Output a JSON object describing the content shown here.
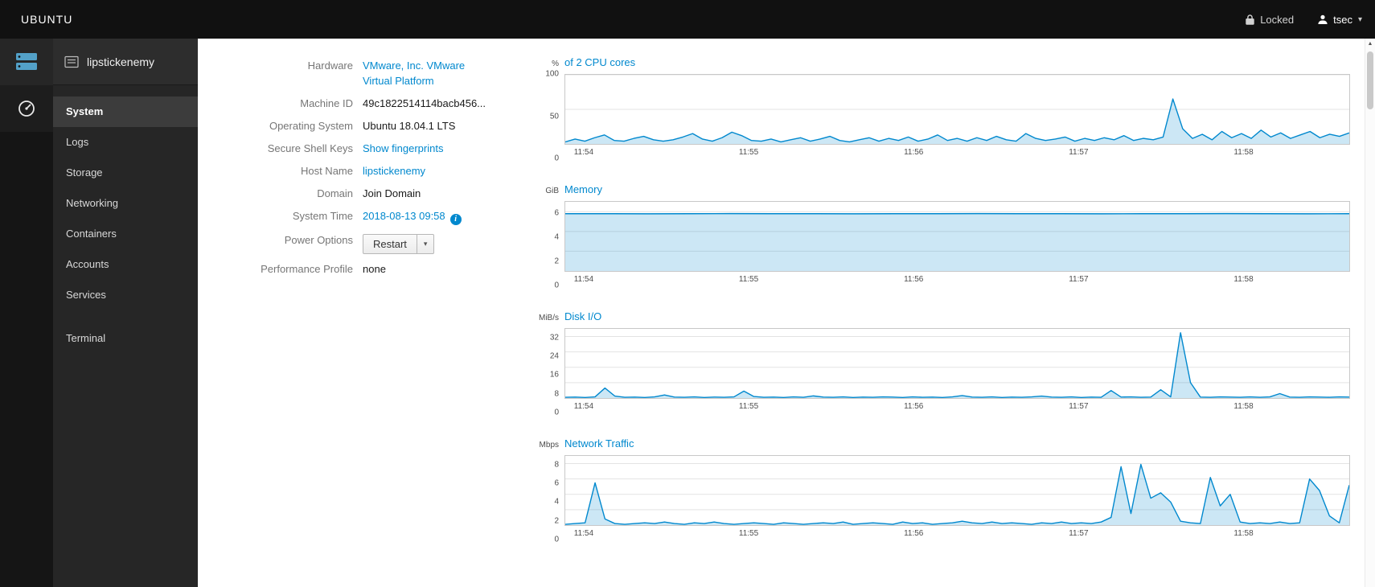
{
  "topbar": {
    "brand": "UBUNTU",
    "locked_label": "Locked",
    "user_label": "tsec"
  },
  "sidebar": {
    "host": "lipstickenemy",
    "items": [
      {
        "label": "System",
        "active": true
      },
      {
        "label": "Logs",
        "active": false
      },
      {
        "label": "Storage",
        "active": false
      },
      {
        "label": "Networking",
        "active": false
      },
      {
        "label": "Containers",
        "active": false
      },
      {
        "label": "Accounts",
        "active": false
      },
      {
        "label": "Services",
        "active": false
      }
    ],
    "tools": [
      {
        "label": "Terminal",
        "active": false
      }
    ]
  },
  "info": {
    "rows": [
      {
        "label": "Hardware",
        "value": "VMware, Inc. VMware Virtual Platform",
        "type": "link"
      },
      {
        "label": "Machine ID",
        "value": "49c1822514114bacb456...",
        "type": "text"
      },
      {
        "label": "Operating System",
        "value": "Ubuntu 18.04.1 LTS",
        "type": "text"
      },
      {
        "label": "Secure Shell Keys",
        "value": "Show fingerprints",
        "type": "link"
      },
      {
        "label": "Host Name",
        "value": "lipstickenemy",
        "type": "link"
      },
      {
        "label": "Domain",
        "value": "Join Domain",
        "type": "action"
      },
      {
        "label": "System Time",
        "value": "2018-08-13 09:58",
        "type": "link-info"
      },
      {
        "label": "Power Options",
        "value": "Restart",
        "type": "button-dropdown"
      },
      {
        "label": "Performance Profile",
        "value": "none",
        "type": "text"
      }
    ]
  },
  "chart_data": [
    {
      "id": "cpu",
      "type": "area",
      "unit": "%",
      "title": "of 2 CPU cores",
      "ylim": [
        0,
        100
      ],
      "yticks": [
        0,
        50,
        100
      ],
      "xticks": [
        "11:54",
        "11:55",
        "11:56",
        "11:57",
        "11:58"
      ],
      "xtick_pos": [
        0.012,
        0.222,
        0.432,
        0.642,
        0.852
      ],
      "values": [
        3,
        7,
        4,
        9,
        13,
        5,
        4,
        8,
        11,
        6,
        4,
        6,
        10,
        15,
        7,
        4,
        9,
        17,
        12,
        5,
        4,
        7,
        3,
        6,
        9,
        4,
        7,
        11,
        5,
        3,
        6,
        9,
        4,
        8,
        5,
        10,
        4,
        7,
        13,
        5,
        8,
        4,
        9,
        5,
        11,
        6,
        4,
        15,
        8,
        5,
        7,
        10,
        4,
        8,
        5,
        9,
        6,
        12,
        5,
        8,
        6,
        10,
        65,
        22,
        8,
        14,
        6,
        18,
        9,
        15,
        8,
        20,
        10,
        16,
        8,
        13,
        18,
        9,
        14,
        11,
        16
      ]
    },
    {
      "id": "memory",
      "type": "area",
      "unit": "GiB",
      "title": "Memory",
      "ylim": [
        0,
        7
      ],
      "yticks": [
        0,
        2,
        4,
        6
      ],
      "xticks": [
        "11:54",
        "11:55",
        "11:56",
        "11:57",
        "11:58"
      ],
      "xtick_pos": [
        0.012,
        0.222,
        0.432,
        0.642,
        0.852
      ],
      "values": [
        5.8,
        5.8,
        5.79,
        5.8,
        5.81,
        5.8,
        5.8,
        5.79,
        5.8,
        5.8,
        5.81,
        5.8,
        5.8,
        5.79,
        5.8,
        5.8,
        5.81,
        5.8,
        5.79,
        5.8
      ]
    },
    {
      "id": "disk",
      "type": "area",
      "unit": "MiB/s",
      "title": "Disk I/O",
      "ylim": [
        0,
        36
      ],
      "yticks": [
        0,
        8,
        16,
        24,
        32
      ],
      "xticks": [
        "11:54",
        "11:55",
        "11:56",
        "11:57",
        "11:58"
      ],
      "xtick_pos": [
        0.012,
        0.222,
        0.432,
        0.642,
        0.852
      ],
      "values": [
        0.4,
        0.5,
        0.3,
        0.6,
        5.2,
        1.0,
        0.4,
        0.5,
        0.3,
        0.6,
        1.6,
        0.5,
        0.4,
        0.6,
        0.3,
        0.5,
        0.4,
        0.6,
        3.6,
        0.8,
        0.4,
        0.5,
        0.3,
        0.6,
        0.4,
        1.1,
        0.5,
        0.4,
        0.6,
        0.3,
        0.5,
        0.4,
        0.6,
        0.5,
        0.3,
        0.6,
        0.4,
        0.5,
        0.3,
        0.6,
        1.3,
        0.5,
        0.4,
        0.6,
        0.3,
        0.5,
        0.4,
        0.6,
        1.0,
        0.5,
        0.4,
        0.6,
        0.3,
        0.5,
        0.4,
        3.9,
        0.5,
        0.6,
        0.4,
        0.5,
        4.3,
        0.6,
        34,
        8.0,
        0.5,
        0.4,
        0.6,
        0.5,
        0.4,
        0.6,
        0.4,
        0.6,
        2.3,
        0.5,
        0.4,
        0.6,
        0.5,
        0.4,
        0.6,
        0.5
      ]
    },
    {
      "id": "network",
      "type": "area",
      "unit": "Mbps",
      "title": "Network Traffic",
      "ylim": [
        0,
        9
      ],
      "yticks": [
        0,
        2,
        4,
        6,
        8
      ],
      "xticks": [
        "11:54",
        "11:55",
        "11:56",
        "11:57",
        "11:58"
      ],
      "xtick_pos": [
        0.012,
        0.222,
        0.432,
        0.642,
        0.852
      ],
      "values": [
        0.1,
        0.2,
        0.3,
        5.5,
        0.8,
        0.2,
        0.1,
        0.2,
        0.3,
        0.2,
        0.4,
        0.2,
        0.1,
        0.3,
        0.2,
        0.4,
        0.2,
        0.1,
        0.2,
        0.3,
        0.2,
        0.1,
        0.3,
        0.2,
        0.1,
        0.2,
        0.3,
        0.2,
        0.4,
        0.1,
        0.2,
        0.3,
        0.2,
        0.1,
        0.4,
        0.2,
        0.3,
        0.1,
        0.2,
        0.3,
        0.5,
        0.3,
        0.2,
        0.4,
        0.2,
        0.3,
        0.2,
        0.1,
        0.3,
        0.2,
        0.4,
        0.2,
        0.3,
        0.2,
        0.4,
        1.0,
        7.6,
        1.5,
        7.9,
        3.5,
        4.2,
        3.0,
        0.5,
        0.3,
        0.2,
        6.2,
        2.5,
        4.0,
        0.4,
        0.2,
        0.3,
        0.2,
        0.4,
        0.2,
        0.3,
        6.0,
        4.5,
        1.2,
        0.3,
        5.2
      ]
    }
  ],
  "colors": {
    "accent": "#0088ce",
    "chart_line": "#0088ce",
    "chart_fill": "rgba(0,136,206,0.2)",
    "grid": "#e3e3e3"
  }
}
